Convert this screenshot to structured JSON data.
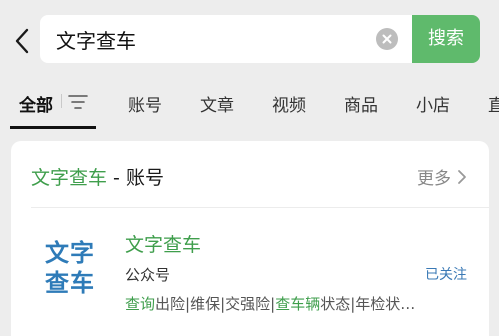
{
  "search": {
    "query": "文字查车",
    "button_label": "搜索"
  },
  "tabs": [
    {
      "label": "全部",
      "active": true
    },
    {
      "label": "账号"
    },
    {
      "label": "文章"
    },
    {
      "label": "视频"
    },
    {
      "label": "商品"
    },
    {
      "label": "小店"
    },
    {
      "label": "直"
    }
  ],
  "section": {
    "title_highlight": "文字查车",
    "title_rest": " - 账号",
    "more_label": "更多"
  },
  "result": {
    "logo_line1": "文字",
    "logo_line2": "查车",
    "name": "文字查车",
    "type": "公众号",
    "follow_status": "已关注",
    "desc_parts": [
      {
        "text": "查询",
        "hl": true
      },
      {
        "text": "出险|维保|交强险|",
        "hl": false
      },
      {
        "text": "查车辆",
        "hl": true
      },
      {
        "text": "状态|年检状…",
        "hl": false
      }
    ]
  },
  "colors": {
    "accent_green": "#5fba6c",
    "highlight_green": "#3f9e4c",
    "logo_blue": "#2e7bb8",
    "link_blue": "#3a79b5",
    "page_bg": "#ededed"
  },
  "icons": {
    "back": "chevron-left-icon",
    "clear": "clear-circle-icon",
    "filter": "filter-lines-icon",
    "more": "chevron-right-icon"
  }
}
